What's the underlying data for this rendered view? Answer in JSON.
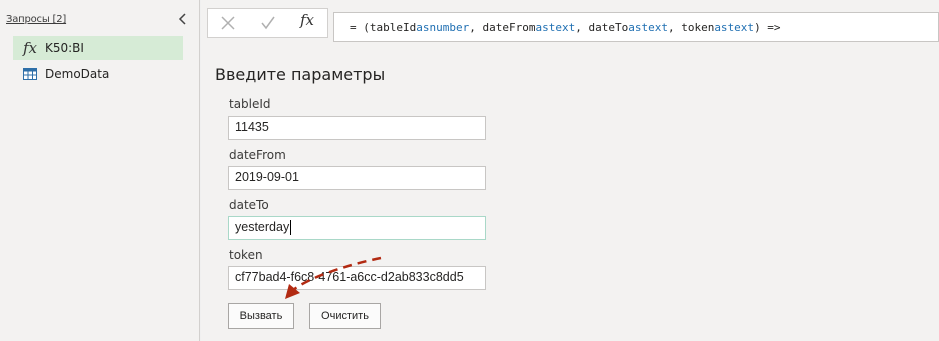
{
  "queries": {
    "header": "Запросы [2]",
    "items": [
      {
        "label": "K50:BI",
        "icon": "function-icon"
      },
      {
        "label": "DemoData",
        "icon": "table-icon"
      }
    ]
  },
  "toolbar": {
    "cancel_icon": "close-icon",
    "commit_icon": "check-icon",
    "fx_label": "fx"
  },
  "formula": {
    "prefix": "= (tableId ",
    "as1": "as",
    "t1": " number",
    "p2": ", dateFrom ",
    "as2": "as",
    "t2": " text",
    "p3": ", dateTo ",
    "as3": "as",
    "t3": " text",
    "p4": ", token ",
    "as4": "as",
    "t4": " text",
    "suffix": ") =>"
  },
  "params": {
    "title": "Введите параметры",
    "fields": [
      {
        "label": "tableId",
        "value": "11435"
      },
      {
        "label": "dateFrom",
        "value": "2019-09-01"
      },
      {
        "label": "dateTo",
        "value": "yesterday"
      },
      {
        "label": "token",
        "value": "cf77bad4-f6c8-4761-a6cc-d2ab833c8dd5"
      }
    ]
  },
  "buttons": {
    "invoke": "Вызвать",
    "clear": "Очистить"
  },
  "colors": {
    "selected_query_bg": "#d6ebd6",
    "keyword": "#1f6fb2",
    "annotation_arrow": "#b22a12"
  }
}
